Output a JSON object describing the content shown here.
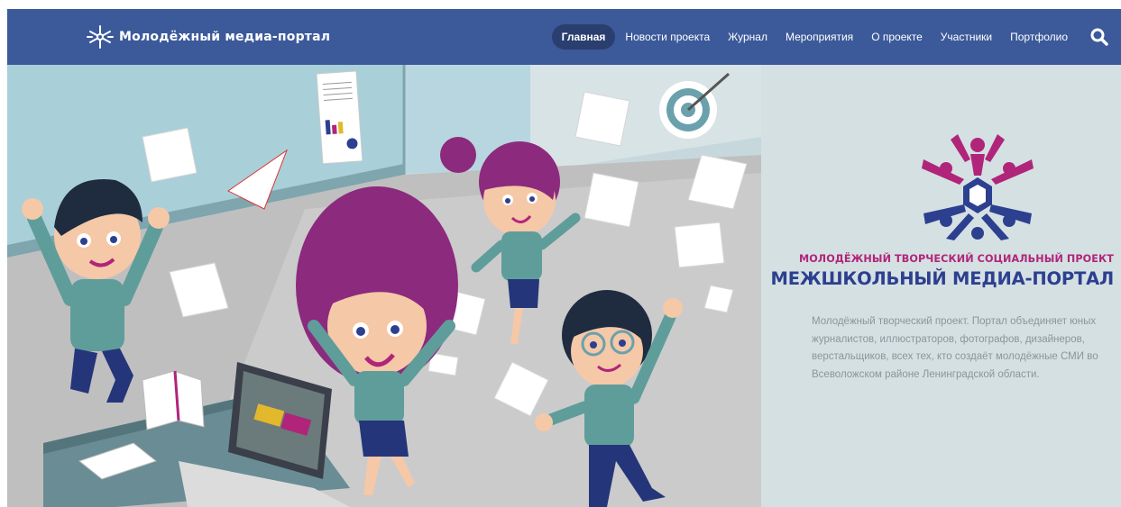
{
  "header": {
    "brand": "Молодёжный медиа-портал",
    "menu": [
      {
        "label": "Главная",
        "active": true
      },
      {
        "label": "Новости проекта",
        "active": false
      },
      {
        "label": "Журнал",
        "active": false
      },
      {
        "label": "Мероприятия",
        "active": false
      },
      {
        "label": "О проекте",
        "active": false
      },
      {
        "label": "Участники",
        "active": false
      },
      {
        "label": "Портфолио",
        "active": false
      }
    ],
    "search_icon": "search-icon",
    "bg_color": "#3c5a9a"
  },
  "hero": {
    "tagline_top": "МОЛОДЁЖНЫЙ ТВОРЧЕСКИЙ СОЦИАЛЬНЫЙ ПРОЕКТ",
    "tagline_main": "МЕЖШКОЛЬНЫЙ МЕДИА-ПОРТАЛ",
    "description": "Молодёжный творческий проект. Портал объединяет юных журналистов, иллюстраторов, фотографов, дизайнеров, верстальщиков, всех тех, кто создаёт молодёжные СМИ во Всеволожском районе Ленинградской области.",
    "colors": {
      "magenta": "#b0257a",
      "navy": "#2d3f8f",
      "panel": "#d5e0e3"
    }
  }
}
